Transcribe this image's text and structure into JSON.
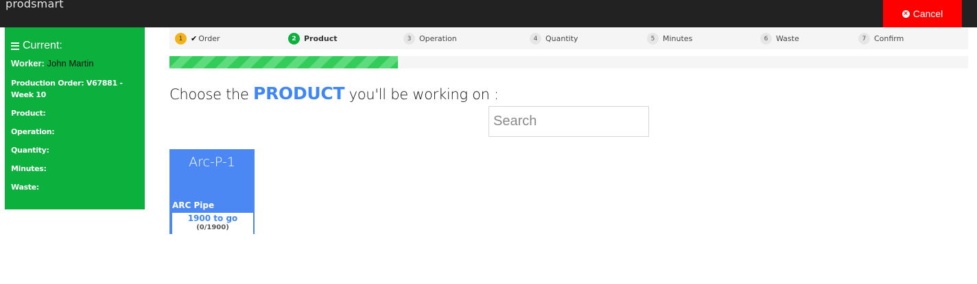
{
  "app": {
    "brand": "prodsmart"
  },
  "header": {
    "cancel_label": "Cancel"
  },
  "sidebar": {
    "title": "Current:",
    "worker_label": "Worker:",
    "worker_value": "John Martin",
    "fields": [
      {
        "label": "Production Order: V67881 - Week 10"
      },
      {
        "label": "Product:"
      },
      {
        "label": "Operation:"
      },
      {
        "label": "Quantity:"
      },
      {
        "label": "Minutes:"
      },
      {
        "label": "Waste:"
      }
    ]
  },
  "steps": [
    {
      "num": "1",
      "label": "Order",
      "state": "done"
    },
    {
      "num": "2",
      "label": "Product",
      "state": "active"
    },
    {
      "num": "3",
      "label": "Operation",
      "state": "pending"
    },
    {
      "num": "4",
      "label": "Quantity",
      "state": "pending"
    },
    {
      "num": "5",
      "label": "Minutes",
      "state": "pending"
    },
    {
      "num": "6",
      "label": "Waste",
      "state": "pending"
    },
    {
      "num": "7",
      "label": "Confirm",
      "state": "pending"
    }
  ],
  "progress": {
    "fraction": 0.286
  },
  "main": {
    "heading_pre": "Choose the ",
    "heading_kw": "PRODUCT",
    "heading_post": " you'll be working on :",
    "search_placeholder": "Search"
  },
  "products": [
    {
      "code": "Arc-P-1",
      "name": "ARC Pipe",
      "togo": "1900 to go",
      "count": "(0/1900)"
    }
  ],
  "colors": {
    "accent_green": "#0bb13c",
    "cancel_red": "#ff0000",
    "primary_blue": "#3f87f5",
    "done_step_yellow": "#f2b21b"
  }
}
